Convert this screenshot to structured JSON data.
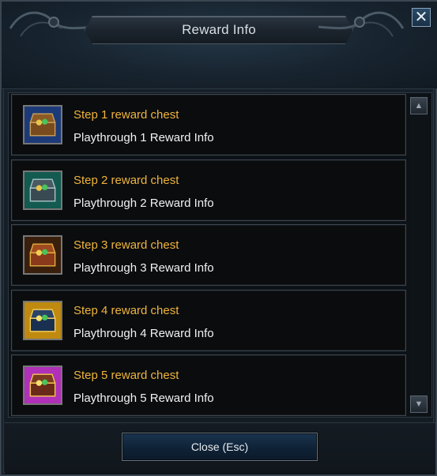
{
  "window": {
    "title": "Reward Info",
    "close_icon": "close-icon"
  },
  "rewards": [
    {
      "title": "Step 1 reward chest",
      "subtitle": "Playthrough 1 Reward Info",
      "chest_color": "#3b5ea8"
    },
    {
      "title": "Step 2 reward chest",
      "subtitle": "Playthrough 2 Reward Info",
      "chest_color": "#1f7a6d"
    },
    {
      "title": "Step 3 reward chest",
      "subtitle": "Playthrough 3 Reward Info",
      "chest_color": "#6b3a1a"
    },
    {
      "title": "Step 4 reward chest",
      "subtitle": "Playthrough 4 Reward Info",
      "chest_color": "#d9a21a"
    },
    {
      "title": "Step 5 reward chest",
      "subtitle": "Playthrough 5 Reward Info",
      "chest_color": "#c23cc9"
    }
  ],
  "footer": {
    "close_label": "Close (Esc)"
  },
  "colors": {
    "title_text": "#d8dde2",
    "reward_title": "#f0b43c",
    "reward_subtitle": "#f2f2f2"
  }
}
